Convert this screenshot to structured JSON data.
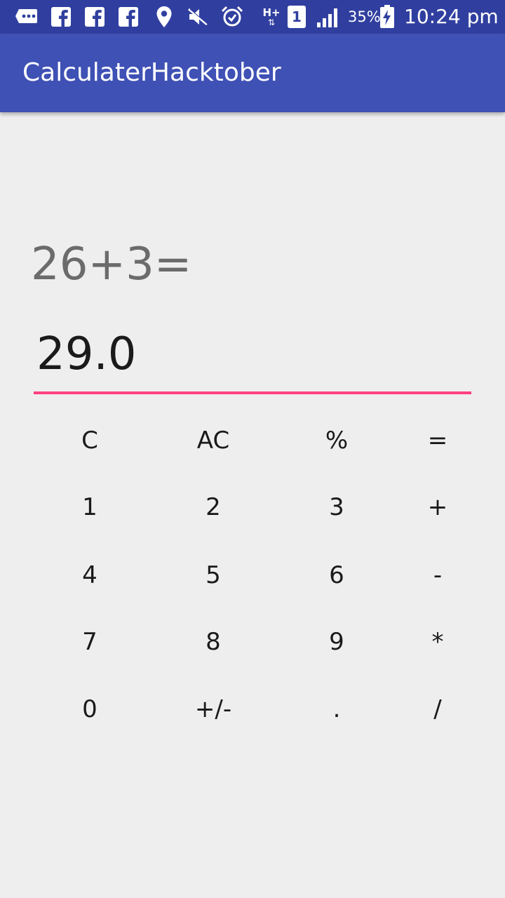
{
  "status_bar": {
    "icons": [
      "message-icon",
      "facebook-icon",
      "facebook-icon",
      "facebook-icon",
      "location-icon",
      "mute-icon",
      "alarm-icon",
      "data-h-plus-icon",
      "sim-1-icon",
      "signal-icon",
      "battery-charging-icon"
    ],
    "data_type": "H+",
    "sim_number": "1",
    "battery_percent": "35%",
    "time": "10:24 pm"
  },
  "app_bar": {
    "title": "CalculaterHacktober",
    "background": "#3f51b5",
    "status_background": "#303f9f"
  },
  "display": {
    "expression": "26+3=",
    "result": "29.0",
    "underline_color": "#ff4081"
  },
  "keypad": {
    "row1": [
      "C",
      "AC",
      "%",
      "="
    ],
    "row2": [
      "1",
      "2",
      "3",
      "+"
    ],
    "row3": [
      "4",
      "5",
      "6",
      "-"
    ],
    "row4": [
      "7",
      "8",
      "9",
      "*"
    ],
    "row5": [
      "0",
      "+/-",
      ".",
      "/"
    ]
  }
}
